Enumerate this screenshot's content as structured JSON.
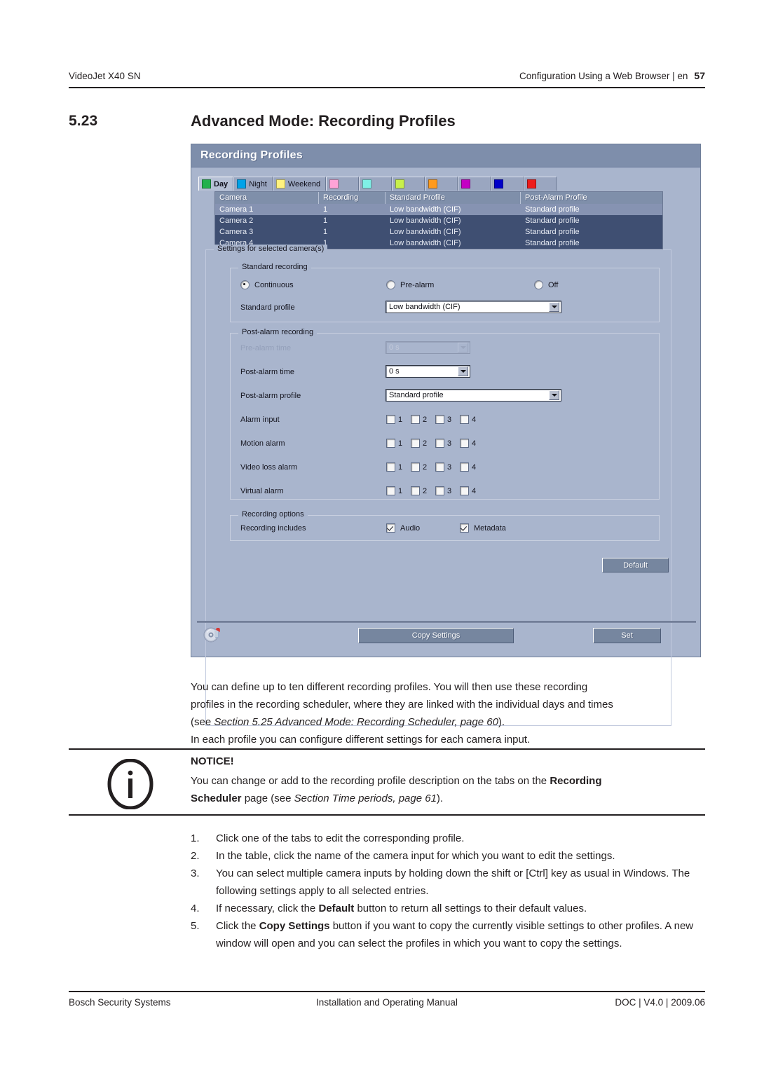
{
  "running_head": {
    "left": "VideoJet X40 SN",
    "right": "Configuration Using a Web Browser | en",
    "page_number": "57"
  },
  "section": {
    "number": "5.23",
    "title": "Advanced Mode: Recording Profiles"
  },
  "dialog": {
    "title": "Recording Profiles",
    "tabs": [
      {
        "label": "Day",
        "color": "#22b14c",
        "active": true
      },
      {
        "label": "Night",
        "color": "#00a2e8",
        "active": false
      },
      {
        "label": "Weekend",
        "color": "#fff27f",
        "active": false
      },
      {
        "label": "",
        "color": "#ffa3d7",
        "active": false
      },
      {
        "label": "",
        "color": "#7ff0e6",
        "active": false
      },
      {
        "label": "",
        "color": "#c8f04a",
        "active": false
      },
      {
        "label": "",
        "color": "#ff9a1e",
        "active": false
      },
      {
        "label": "",
        "color": "#c400c4",
        "active": false
      },
      {
        "label": "",
        "color": "#0000c8",
        "active": false
      },
      {
        "label": "",
        "color": "#ee1b1b",
        "active": false
      }
    ],
    "table": {
      "columns": [
        "Camera",
        "Recording",
        "Standard Profile",
        "Post-Alarm Profile"
      ],
      "rows": [
        {
          "camera": "Camera 1",
          "recording": "1",
          "standard_profile": "Low bandwidth (CIF)",
          "post_alarm_profile": "Standard profile",
          "selected": true
        },
        {
          "camera": "Camera 2",
          "recording": "1",
          "standard_profile": "Low bandwidth (CIF)",
          "post_alarm_profile": "Standard profile",
          "selected": false
        },
        {
          "camera": "Camera 3",
          "recording": "1",
          "standard_profile": "Low bandwidth (CIF)",
          "post_alarm_profile": "Standard profile",
          "selected": false
        },
        {
          "camera": "Camera 4",
          "recording": "1",
          "standard_profile": "Low bandwidth (CIF)",
          "post_alarm_profile": "Standard profile",
          "selected": false
        }
      ]
    },
    "settings_legend": "Settings for selected camera(s)",
    "standard_recording": {
      "legend": "Standard recording",
      "radio_continuous": "Continuous",
      "radio_prealarm": "Pre-alarm",
      "radio_off": "Off",
      "selected_mode": "Continuous",
      "standard_profile_label": "Standard profile",
      "standard_profile_value": "Low bandwidth (CIF)"
    },
    "post_alarm_recording": {
      "legend": "Post-alarm recording",
      "prealarm_time_label": "Pre-alarm time",
      "prealarm_time_value": "0 s",
      "postalarm_time_label": "Post-alarm time",
      "postalarm_time_value": "0 s",
      "postalarm_profile_label": "Post-alarm profile",
      "postalarm_profile_value": "Standard profile",
      "alarm_rows": [
        {
          "label": "Alarm input",
          "boxes": [
            "1",
            "2",
            "3",
            "4"
          ]
        },
        {
          "label": "Motion alarm",
          "boxes": [
            "1",
            "2",
            "3",
            "4"
          ]
        },
        {
          "label": "Video loss alarm",
          "boxes": [
            "1",
            "2",
            "3",
            "4"
          ]
        },
        {
          "label": "Virtual alarm",
          "boxes": [
            "1",
            "2",
            "3",
            "4"
          ]
        }
      ]
    },
    "recording_options": {
      "legend": "Recording options",
      "includes_label": "Recording includes",
      "audio_label": "Audio",
      "audio_checked": true,
      "metadata_label": "Metadata",
      "metadata_checked": true
    },
    "buttons": {
      "default": "Default",
      "copy_settings": "Copy Settings",
      "set": "Set"
    }
  },
  "body": {
    "p1_line1": "You can define up to ten different recording profiles. You will then use these recording",
    "p1_line2": "profiles in the recording scheduler, where they are linked with the individual days and times",
    "p1_line3_a": "(see ",
    "p1_line3_i": "Section 5.25 Advanced Mode: Recording Scheduler, page 60",
    "p1_line3_b": ").",
    "p1_line4": "In each profile you can configure different settings for each camera input."
  },
  "notice": {
    "heading": "NOTICE!",
    "line1_a": "You can change or add to the recording profile description on the tabs on the ",
    "line1_b": "Recording",
    "line2_b": "Scheduler",
    "line2_a": " page (see ",
    "line2_i": "Section  Time periods, page 61",
    "line2_c": ")."
  },
  "steps": [
    {
      "n": "1.",
      "t": "Click one of the tabs to edit the corresponding profile."
    },
    {
      "n": "2.",
      "t": "In the table, click the name of the camera input for which you want to edit the settings."
    },
    {
      "n": "3.",
      "t": "You can select multiple camera inputs by holding down the shift or [Ctrl] key as usual in Windows. The following settings apply to all selected entries."
    },
    {
      "n": "4.",
      "t4a": "If necessary, click the ",
      "t4b": "Default",
      "t4c": " button to return all settings to their default values."
    },
    {
      "n": "5.",
      "t5a": "Click the ",
      "t5b": "Copy Settings",
      "t5c": " button if you want to copy the currently visible settings to other profiles. A new window will open and you can select the profiles in which you want to copy the settings."
    }
  ],
  "footer": {
    "left": "Bosch Security Systems",
    "center": "Installation and Operating Manual",
    "right": "DOC | V4.0 | 2009.06"
  }
}
